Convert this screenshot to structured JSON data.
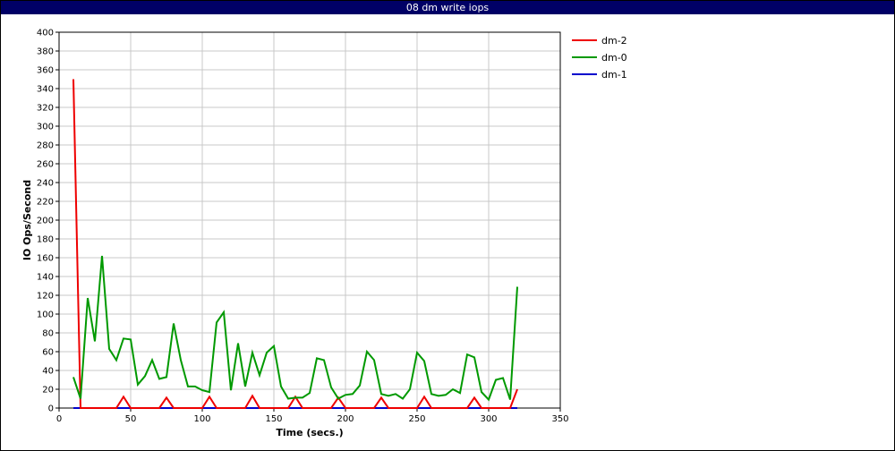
{
  "window": {
    "title": "08 dm write iops"
  },
  "chart_data": {
    "type": "line",
    "title": "08 dm write iops",
    "xlabel": "Time (secs.)",
    "ylabel": "IO Ops/Second",
    "xlim": [
      0,
      350
    ],
    "ylim": [
      0,
      400
    ],
    "xticks": [
      0,
      50,
      100,
      150,
      200,
      250,
      300,
      350
    ],
    "yticks": [
      0,
      20,
      40,
      60,
      80,
      100,
      120,
      140,
      160,
      180,
      200,
      220,
      240,
      260,
      280,
      300,
      320,
      340,
      360,
      380,
      400
    ],
    "grid": true,
    "legend_position": "right",
    "x": [
      10,
      15,
      20,
      25,
      30,
      35,
      40,
      45,
      50,
      55,
      60,
      65,
      70,
      75,
      80,
      85,
      90,
      95,
      100,
      105,
      110,
      115,
      120,
      125,
      130,
      135,
      140,
      145,
      150,
      155,
      160,
      165,
      170,
      175,
      180,
      185,
      190,
      195,
      200,
      205,
      210,
      215,
      220,
      225,
      230,
      235,
      240,
      245,
      250,
      255,
      260,
      265,
      270,
      275,
      280,
      285,
      290,
      295,
      300,
      305,
      310,
      315,
      320
    ],
    "series": [
      {
        "name": "dm-2",
        "color": "#ee0000",
        "values": [
          350,
          0,
          0,
          0,
          0,
          0,
          0,
          12,
          0,
          0,
          0,
          0,
          0,
          11,
          0,
          0,
          0,
          0,
          0,
          12,
          0,
          0,
          0,
          0,
          0,
          13,
          0,
          0,
          0,
          0,
          0,
          12,
          0,
          0,
          0,
          0,
          0,
          11,
          0,
          0,
          0,
          0,
          0,
          11,
          0,
          0,
          0,
          0,
          0,
          12,
          0,
          0,
          0,
          0,
          0,
          0,
          11,
          0,
          0,
          0,
          0,
          0,
          20
        ]
      },
      {
        "name": "dm-0",
        "color": "#009900",
        "values": [
          33,
          10,
          117,
          71,
          162,
          63,
          51,
          74,
          73,
          25,
          34,
          51,
          31,
          33,
          90,
          51,
          23,
          23,
          19,
          17,
          91,
          102,
          19,
          69,
          23,
          59,
          35,
          59,
          66,
          23,
          10,
          11,
          11,
          16,
          53,
          51,
          22,
          10,
          14,
          15,
          24,
          60,
          51,
          15,
          13,
          15,
          10,
          20,
          59,
          50,
          15,
          13,
          14,
          20,
          16,
          57,
          54,
          17,
          9,
          30,
          32,
          9,
          129
        ]
      },
      {
        "name": "dm-1",
        "color": "#0000cc",
        "values": [
          0,
          0,
          0,
          0,
          0,
          0,
          0,
          0,
          0,
          0,
          0,
          0,
          0,
          0,
          0,
          0,
          0,
          0,
          0,
          0,
          0,
          0,
          0,
          0,
          0,
          0,
          0,
          0,
          0,
          0,
          0,
          0,
          0,
          0,
          0,
          0,
          0,
          0,
          0,
          0,
          0,
          0,
          0,
          0,
          0,
          0,
          0,
          0,
          0,
          0,
          0,
          0,
          0,
          0,
          0,
          0,
          0,
          0,
          0,
          0,
          0,
          0,
          0
        ]
      }
    ]
  }
}
